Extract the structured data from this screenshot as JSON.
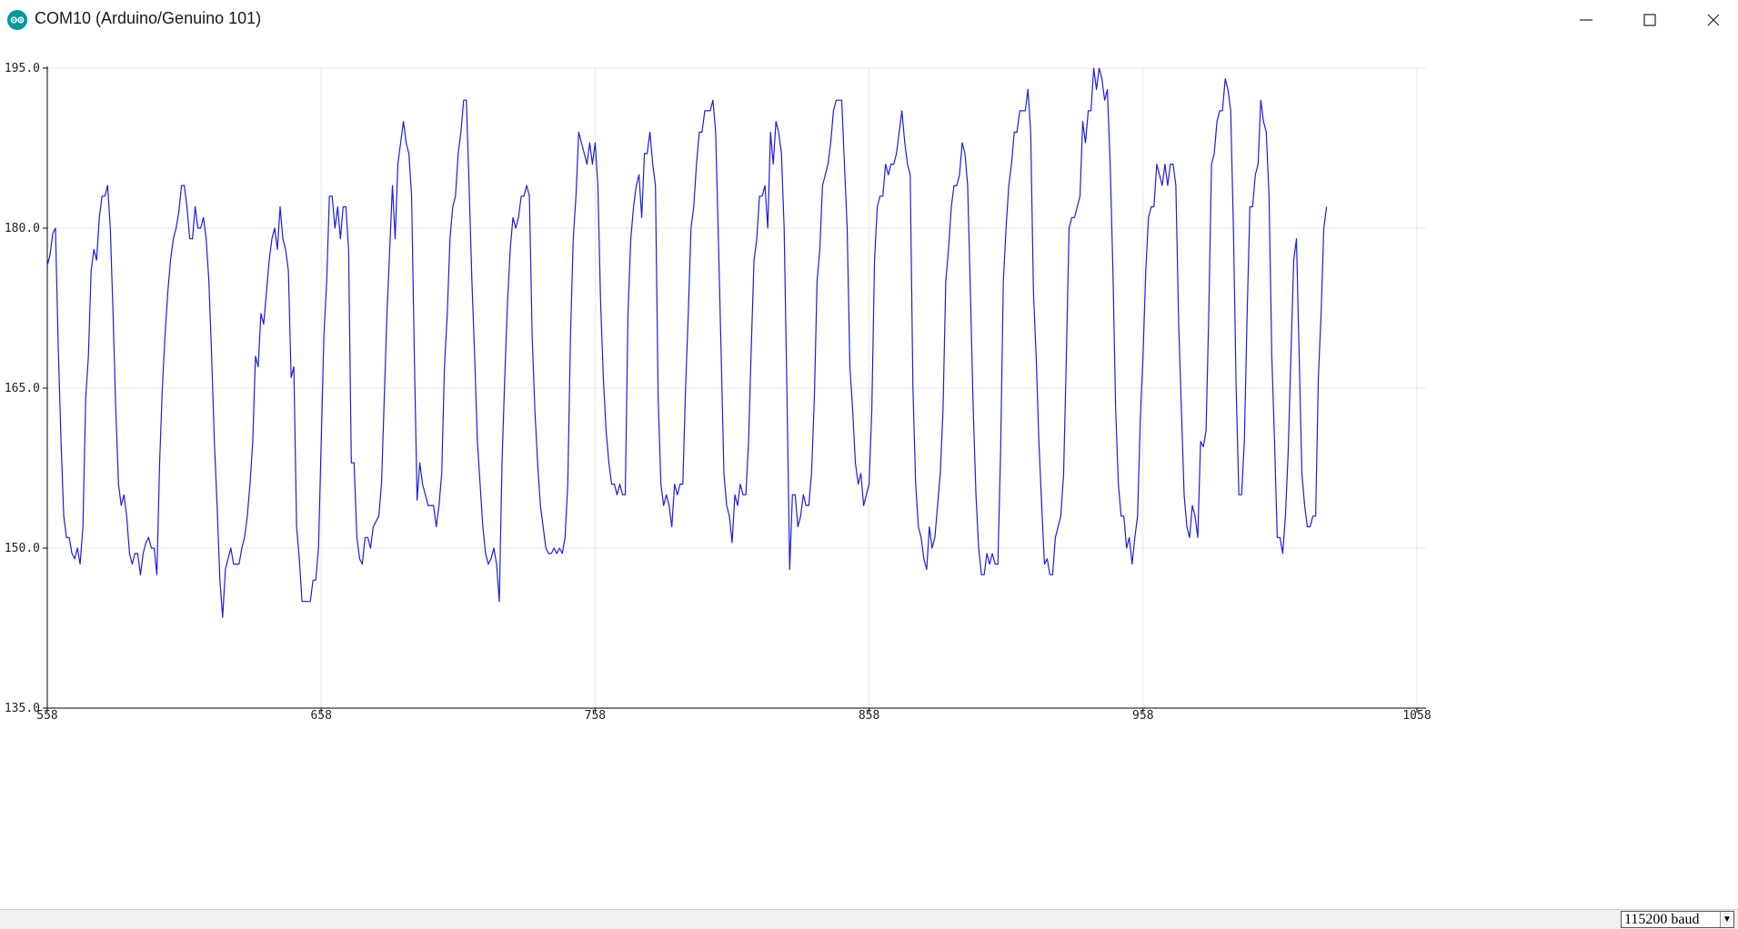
{
  "window": {
    "title": "COM10 (Arduino/Genuino 101)",
    "icon": "arduino-logo-icon",
    "controls": [
      "minimize-icon",
      "maximize-icon",
      "close-icon"
    ]
  },
  "statusbar": {
    "baud_rate": "115200 baud"
  },
  "colors": {
    "line": "#1c1ce6",
    "grid": "#e8e8e8",
    "axis": "#000000",
    "logo": "#00979d"
  },
  "chart_data": {
    "type": "line",
    "title": "",
    "xlabel": "",
    "ylabel": "",
    "xlim": [
      558,
      1058
    ],
    "ylim": [
      135,
      195
    ],
    "x_ticks": [
      "558",
      "658",
      "758",
      "858",
      "958",
      "1058"
    ],
    "y_ticks": [
      "135.0",
      "150.0",
      "165.0",
      "180.0",
      "195.0"
    ],
    "grid": true,
    "x_start": 558,
    "series": [
      {
        "values": [
          176.5,
          177.5,
          179.5,
          180,
          169,
          160,
          153,
          151,
          151,
          149.5,
          149,
          150,
          148.5,
          152,
          164,
          168,
          176,
          178,
          177,
          181,
          183,
          183,
          184,
          180,
          172,
          163,
          156,
          154,
          155,
          153,
          149.5,
          148.5,
          149.5,
          149.5,
          147.5,
          149.5,
          150.5,
          151,
          150,
          150,
          147.5,
          158,
          165,
          170,
          174,
          177,
          179,
          180,
          181.5,
          184,
          184,
          182,
          179,
          179,
          182,
          180,
          180,
          181,
          179,
          175,
          168,
          160,
          154,
          147,
          143.5,
          148,
          149,
          150,
          148.5,
          148.5,
          148.5,
          150,
          151,
          153,
          156,
          160,
          168,
          167,
          172,
          171,
          174,
          177,
          179,
          180,
          178,
          182,
          179,
          178,
          176,
          166,
          167,
          152,
          149,
          145,
          145,
          145,
          145,
          147,
          147,
          150,
          160,
          170,
          175,
          183,
          183,
          180,
          182,
          179,
          182,
          182,
          178,
          158,
          158,
          151,
          149,
          148.5,
          151,
          151,
          150,
          152,
          152.5,
          153,
          156,
          164,
          172,
          178,
          184,
          179,
          186,
          188,
          190,
          188,
          187,
          183,
          168,
          154.5,
          158,
          156,
          155,
          154,
          154,
          154,
          152,
          154,
          157,
          167,
          172,
          179,
          182,
          183,
          187,
          189,
          192,
          192,
          184,
          175,
          168,
          160,
          156,
          152,
          149.5,
          148.5,
          149,
          150,
          148.5,
          145,
          158,
          166,
          173,
          178,
          181,
          180,
          181,
          183,
          183,
          184,
          183,
          170,
          163,
          158,
          154,
          152,
          150,
          149.5,
          149.5,
          150,
          149.5,
          150,
          149.5,
          151,
          156,
          170,
          179,
          183,
          189,
          188,
          187,
          186,
          188,
          186,
          188,
          184,
          173,
          166,
          161,
          158,
          156,
          156,
          155,
          156,
          155,
          155,
          172,
          179,
          182,
          184,
          185,
          181,
          187,
          187,
          189,
          186,
          184,
          164,
          156,
          154,
          155,
          154,
          152,
          156,
          155,
          156,
          156,
          165,
          172,
          180,
          182,
          186,
          189,
          189,
          191,
          191,
          191,
          192,
          189,
          179,
          168,
          157,
          154,
          153,
          150.5,
          155,
          154,
          156,
          155,
          155,
          160,
          169,
          177,
          179,
          183,
          183,
          184,
          180,
          189,
          186,
          190,
          189,
          187,
          180,
          165,
          148,
          155,
          155,
          152,
          153,
          155,
          154,
          154,
          157,
          164,
          175,
          178,
          184,
          185,
          186,
          188,
          191,
          192,
          192,
          192,
          186,
          180,
          167,
          163,
          158,
          156,
          157,
          154,
          155,
          156,
          163,
          177,
          182,
          183,
          183,
          186,
          185,
          186,
          186,
          187,
          189,
          191,
          188,
          186,
          185,
          165,
          156,
          152,
          151,
          149,
          148,
          152,
          150,
          151,
          154,
          157,
          163,
          175,
          178,
          182,
          184,
          184,
          185,
          188,
          187,
          184,
          174,
          163,
          155,
          150,
          147.5,
          147.5,
          149.5,
          148.5,
          149.5,
          148.5,
          148.5,
          159,
          175,
          180,
          184,
          186,
          189,
          189,
          191,
          191,
          191,
          193,
          189,
          174,
          168,
          160,
          154,
          148.5,
          149,
          147.5,
          147.5,
          151,
          152,
          153,
          157,
          168,
          180,
          181,
          181,
          182,
          183,
          190,
          188,
          191,
          191,
          195,
          193,
          195,
          194,
          192,
          193,
          186,
          176,
          163,
          156,
          153,
          153,
          150,
          151,
          148.5,
          151,
          153,
          162,
          168,
          176,
          181,
          182,
          182,
          186,
          185,
          184,
          186,
          184,
          186,
          186,
          184,
          171,
          163,
          155,
          152,
          151,
          154,
          153,
          151,
          160,
          159.5,
          161,
          172,
          186,
          187,
          190,
          191,
          191,
          194,
          193,
          191,
          180,
          165,
          155,
          155,
          160,
          172,
          182,
          182,
          185,
          186,
          192,
          190,
          189,
          183,
          168,
          160,
          151,
          151,
          149.5,
          153,
          159,
          168,
          177,
          179,
          168,
          157,
          154,
          152,
          152,
          153,
          153,
          166,
          172,
          180,
          182
        ]
      }
    ]
  }
}
